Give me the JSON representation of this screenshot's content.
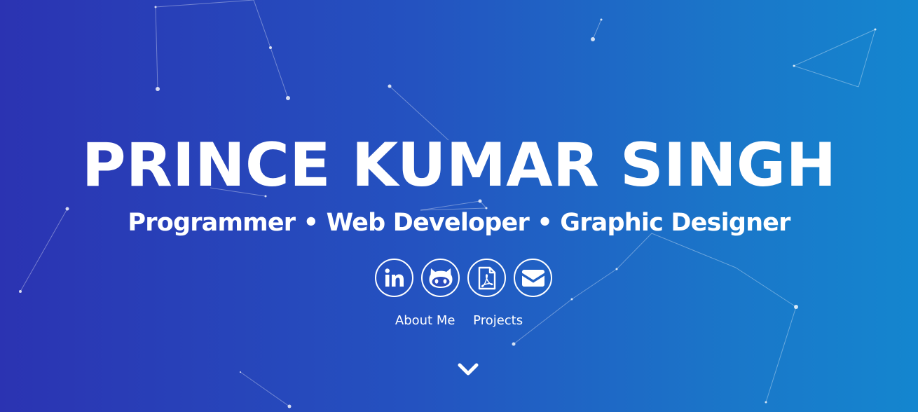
{
  "hero": {
    "name": "PRINCE KUMAR SINGH",
    "tagline": "Programmer • Web Developer • Graphic Designer",
    "background": {
      "gradient_start": "#2b33b2",
      "gradient_end": "#1486cf"
    }
  },
  "socials": [
    {
      "icon": "linkedin-icon",
      "title": "LinkedIn"
    },
    {
      "icon": "github-icon",
      "title": "GitHub"
    },
    {
      "icon": "pdf-icon",
      "title": "Resume PDF"
    },
    {
      "icon": "envelope-icon",
      "title": "Email"
    }
  ],
  "nav": {
    "about_label": "About Me",
    "projects_label": "Projects"
  },
  "scroll": {
    "icon": "chevron-down-icon"
  }
}
